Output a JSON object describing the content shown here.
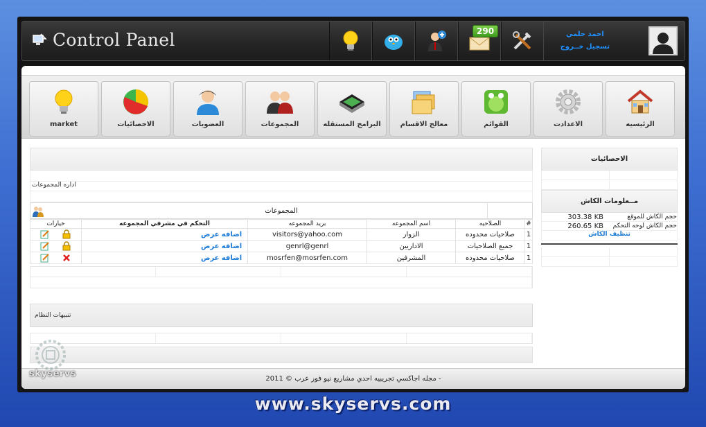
{
  "topbar": {
    "title": "Control Panel",
    "notification_count": "290",
    "icons": [
      "lightbulb-icon",
      "twitter-bird-icon",
      "add-user-icon",
      "mail-icon",
      "tools-icon"
    ],
    "user_name": "احمد حلمي",
    "logout": "تسجيل خــروج"
  },
  "nav": {
    "items": [
      {
        "label": "market",
        "icon": "lightbulb-icon"
      },
      {
        "label": "الاحصائيات",
        "icon": "pie-chart-icon"
      },
      {
        "label": "العضويات",
        "icon": "user-icon"
      },
      {
        "label": "المجموعات",
        "icon": "group-icon"
      },
      {
        "label": "البرامج المستقله",
        "icon": "program-icon"
      },
      {
        "label": "معالج الاقسام",
        "icon": "folders-icon"
      },
      {
        "label": "القوائم",
        "icon": "list-icon"
      },
      {
        "label": "الاعدادت",
        "icon": "gear-icon"
      },
      {
        "label": "الرئيسيه",
        "icon": "home-icon"
      }
    ]
  },
  "main": {
    "manage_groups": "اداره المجموعات",
    "groups_title": "المجموعات",
    "table": {
      "headers": {
        "options": "خيارات",
        "control": "التحكم في مشرفي المجموعه",
        "email": "بريد المجموعه",
        "name": "اسم المجموعه",
        "permission": "الصلاحيه",
        "num": "#"
      },
      "rows": [
        {
          "add": "اضافه",
          "view": "عرض",
          "email": "visitors@yahoo.com",
          "name": "الزوار",
          "permission": "صلاحيات محدوده",
          "num": "1",
          "deletable": false
        },
        {
          "add": "اضافه",
          "view": "عرض",
          "email": "genrl@genrl",
          "name": "الاداريين",
          "permission": "جميع الصلاحيات",
          "num": "1",
          "deletable": false
        },
        {
          "add": "اضافه",
          "view": "عرض",
          "email": "mosrfen@mosrfen.com",
          "name": "المشرفين",
          "permission": "صلاحيات محدوده",
          "num": "1",
          "deletable": true
        }
      ]
    },
    "alerts": "تنبيهات النظام"
  },
  "sidebar": {
    "stats_title": "الاحصائيات",
    "cache_title": "مــعلومات الكاش",
    "site_cache_label": "حجم الكاش للموقع",
    "site_cache_value": "303.38 KB",
    "cp_cache_label": "حجم الكاش لوحه التحكم",
    "cp_cache_value": "260.65 KB",
    "clear_cache": "تنظيف الكاش"
  },
  "footer": {
    "copyright": "- مجله اجاكسي تجريبيه احدي مشاريع نيو فور عرب © 2011"
  },
  "watermark": {
    "text": "skyservs",
    "url": "www.skyservs.com"
  }
}
